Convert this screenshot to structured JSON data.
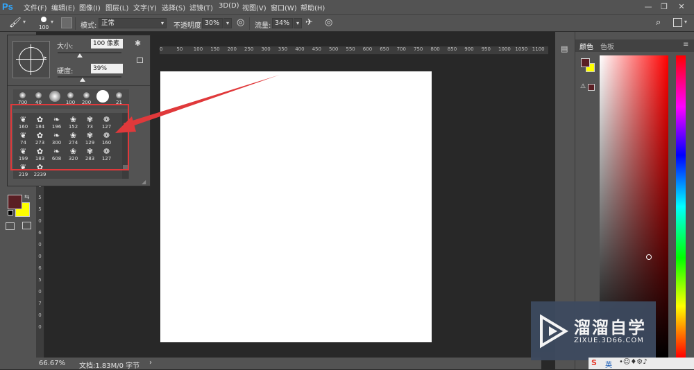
{
  "app": {
    "logo": "Ps"
  },
  "menu": [
    "文件(F)",
    "编辑(E)",
    "图像(I)",
    "图层(L)",
    "文字(Y)",
    "选择(S)",
    "滤镜(T)",
    "3D(D)",
    "视图(V)",
    "窗口(W)",
    "帮助(H)"
  ],
  "window_controls": {
    "minimize": "—",
    "restore": "❐",
    "close": "✕"
  },
  "options": {
    "brush_size": "100",
    "mode_label": "模式:",
    "mode_value": "正常",
    "opacity_label": "不透明度:",
    "opacity_value": "30%",
    "flow_label": "流量:",
    "flow_value": "34%"
  },
  "brush_panel": {
    "size_label": "大小:",
    "size_value": "100 像素",
    "size_level": 0.35,
    "hardness_label": "硬度:",
    "hardness_value": "39%",
    "hardness_level": 0.39,
    "top_presets": [
      "700",
      "40",
      "",
      "100",
      "200",
      "",
      "21"
    ],
    "presets": [
      [
        "160",
        "184",
        "196",
        "152",
        "73",
        "127"
      ],
      [
        "74",
        "273",
        "300",
        "274",
        "129",
        "160"
      ],
      [
        "199",
        "183",
        "608",
        "320",
        "283",
        "127"
      ],
      [
        "219",
        "2239"
      ]
    ]
  },
  "ruler_top": [
    "0",
    "50",
    "100",
    "150",
    "200",
    "250",
    "300",
    "350",
    "400",
    "450",
    "500",
    "550",
    "600",
    "650",
    "700",
    "750",
    "800",
    "850",
    "900",
    "950",
    "1000",
    "1050",
    "1100",
    "1150"
  ],
  "ruler_left": [
    "3",
    "5",
    "0",
    "4",
    "0",
    "0",
    "4",
    "5",
    "0",
    "5",
    "0",
    "0",
    "5",
    "5",
    "0",
    "6",
    "0",
    "0",
    "6",
    "5",
    "0",
    "7",
    "0",
    "0"
  ],
  "status": {
    "zoom": "66.67%",
    "doc_info": "文档:1.83M/0 字节"
  },
  "panels": {
    "color_tab": "颜色",
    "swatches_tab": "色板"
  },
  "colors": {
    "foreground": "#5a1f24",
    "background": "#ffff00",
    "accent_arrow": "#e0393b"
  },
  "watermark": {
    "title": "溜溜自学",
    "url": "ZIXUE.3D66.COM"
  },
  "taskbar": {
    "ime": "英"
  }
}
